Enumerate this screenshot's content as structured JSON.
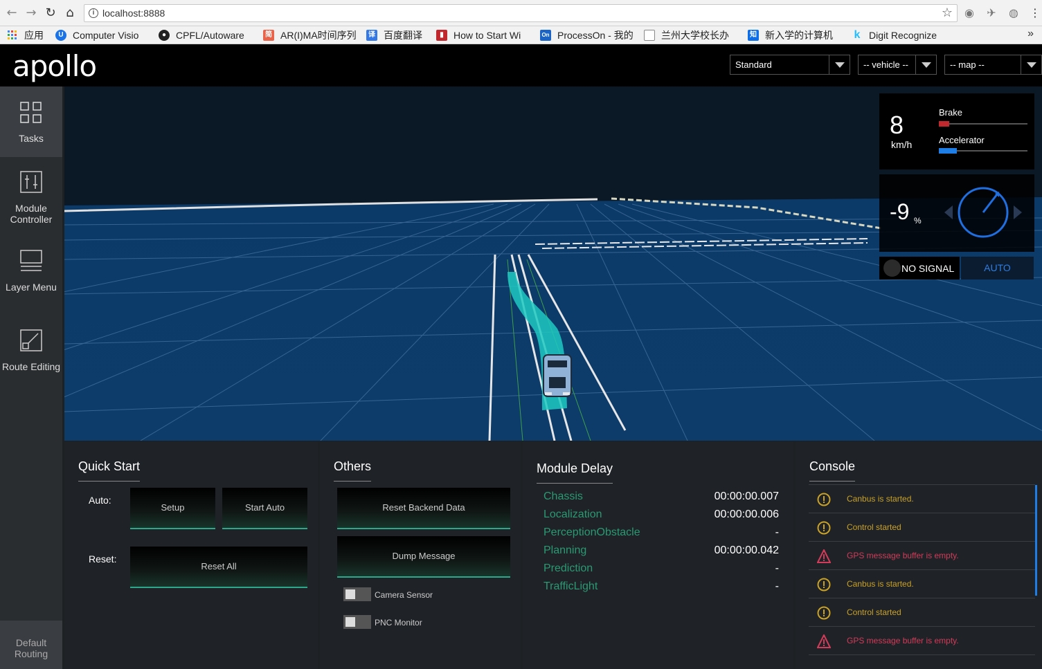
{
  "browser": {
    "url": "localhost:8888",
    "bookmarks": [
      {
        "label": "应用",
        "icon": "apps-grid-icon"
      },
      {
        "label": "Computer Visio",
        "icon": "u-logo-icon"
      },
      {
        "label": "CPFL/Autoware",
        "icon": "github-icon"
      },
      {
        "label": "AR(I)MA时间序列",
        "icon": "jianshu-icon"
      },
      {
        "label": "百度翻译",
        "icon": "baidu-translate-icon"
      },
      {
        "label": "How to Start Wi",
        "icon": "bookmark-icon"
      },
      {
        "label": "ProcessOn - 我的",
        "icon": "processon-icon"
      },
      {
        "label": "兰州大学校长办",
        "icon": "page-icon"
      },
      {
        "label": "新入学的计算机",
        "icon": "zhihu-icon"
      },
      {
        "label": "Digit Recognize",
        "icon": "kaggle-icon"
      }
    ],
    "more": "»"
  },
  "header": {
    "logo": "apollo",
    "mode": "Standard",
    "vehicle": "-- vehicle --",
    "map": "-- map --"
  },
  "sidebar": {
    "items": [
      {
        "label": "Tasks",
        "icon": "tasks-grid-icon"
      },
      {
        "label": "Module Controller",
        "icon": "module-controller-icon"
      },
      {
        "label": "Layer Menu",
        "icon": "layer-menu-icon"
      },
      {
        "label": "Route Editing",
        "icon": "route-editing-icon"
      }
    ],
    "bottom": "Default Routing"
  },
  "dashboard": {
    "speed": "8",
    "speed_unit": "km/h",
    "brake_label": "Brake",
    "accelerator_label": "Accelerator",
    "brake_level": 0.12,
    "accelerator_level": 0.2,
    "steering": "-9",
    "steering_unit": "%",
    "signal": "NO SIGNAL",
    "drive_mode": "AUTO"
  },
  "quick_start": {
    "title": "Quick Start",
    "auto_label": "Auto:",
    "setup": "Setup",
    "start_auto": "Start Auto",
    "reset_label": "Reset:",
    "reset_all": "Reset All"
  },
  "others": {
    "title": "Others",
    "reset_backend": "Reset Backend Data",
    "dump_message": "Dump Message",
    "camera_sensor": "Camera Sensor",
    "pnc_monitor": "PNC Monitor"
  },
  "module_delay": {
    "title": "Module Delay",
    "rows": [
      {
        "name": "Chassis",
        "value": "00:00:00.007"
      },
      {
        "name": "Localization",
        "value": "00:00:00.006"
      },
      {
        "name": "PerceptionObstacle",
        "value": "-"
      },
      {
        "name": "Planning",
        "value": "00:00:00.042"
      },
      {
        "name": "Prediction",
        "value": "-"
      },
      {
        "name": "TrafficLight",
        "value": "-"
      }
    ]
  },
  "console": {
    "title": "Console",
    "messages": [
      {
        "text": "Canbus is started.",
        "level": "warning"
      },
      {
        "text": "Control started",
        "level": "warning"
      },
      {
        "text": "GPS message buffer is empty.",
        "level": "error"
      },
      {
        "text": "Canbus is started.",
        "level": "warning"
      },
      {
        "text": "Control started",
        "level": "warning"
      },
      {
        "text": "GPS message buffer is empty.",
        "level": "error"
      }
    ]
  },
  "colors": {
    "accent_green": "#2ea88b",
    "delay_green": "#2a9a72",
    "warning": "#c9a227",
    "error": "#d23c5a",
    "auto_blue": "#2e7de0",
    "brake_red": "#c0282d",
    "accel_blue": "#1f7de6"
  }
}
